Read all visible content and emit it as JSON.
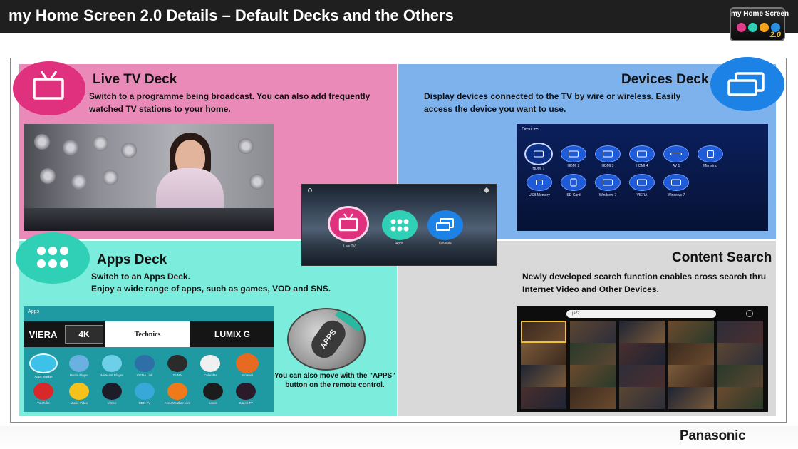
{
  "header": {
    "title": "my Home Screen 2.0 Details – Default Decks and the Others",
    "logo": {
      "text": "my Home Screen",
      "version": "2.0",
      "dot_colors": [
        "#e23b8a",
        "#2fd0b5",
        "#f4a21a",
        "#2a8fe0"
      ]
    }
  },
  "live_tv": {
    "heading": "Live TV Deck",
    "desc": "Switch to a programme being broadcast. You can also add frequently watched TV stations to your home.",
    "icon": "tv-icon",
    "color": "#ea8ab9",
    "accent": "#e0317f"
  },
  "devices": {
    "heading": "Devices Deck",
    "desc": "Display devices connected to the TV by wire or wireless. Easily access the device you want to use.",
    "icon": "devices-icon",
    "color": "#7eb2ec",
    "accent": "#1d82e6",
    "screen_title": "Devices",
    "items": [
      {
        "label": "HDMI 1"
      },
      {
        "label": "HDMI 2"
      },
      {
        "label": "HDMI 3"
      },
      {
        "label": "HDMI 4"
      },
      {
        "label": "AV 1"
      },
      {
        "label": "Mirroring"
      },
      {
        "label": "USB Memory"
      },
      {
        "label": "SD Card"
      },
      {
        "label": "Windows 7"
      },
      {
        "label": "VIERA"
      },
      {
        "label": "Windows 7"
      }
    ]
  },
  "apps": {
    "heading": "Apps Deck",
    "desc_line1": "Switch to an Apps Deck.",
    "desc_line2": "Enjoy a wide range of apps, such as games, VOD and SNS.",
    "icon": "apps-grid-icon",
    "color": "#7cecdc",
    "accent": "#2fd0b5",
    "screen_title": "Apps",
    "brands": [
      "VIERA",
      "4K",
      "Technics",
      "LUMIX G"
    ],
    "items": [
      {
        "label": "Apps Market",
        "color": "#3cc1e8"
      },
      {
        "label": "Media Player",
        "color": "#6ab0e0"
      },
      {
        "label": "Miracast Player",
        "color": "#6ecfe8"
      },
      {
        "label": "VIERA Link",
        "color": "#2e6fa8"
      },
      {
        "label": "DLNA",
        "color": "#2b2b2b"
      },
      {
        "label": "Calendar",
        "color": "#f0f0f0"
      },
      {
        "label": "Browser",
        "color": "#e66a1f"
      },
      {
        "label": "YouTube",
        "color": "#d8282a"
      },
      {
        "label": "Music Video",
        "color": "#f6c21a"
      },
      {
        "label": "Vimeo",
        "color": "#1d1d2a"
      },
      {
        "label": "CBN TV",
        "color": "#38a8d8"
      },
      {
        "label": "AccuWeather.com",
        "color": "#f07a1a"
      },
      {
        "label": "tunein",
        "color": "#1c1c1c"
      },
      {
        "label": "Gazeti TV",
        "color": "#2a1a2a"
      }
    ],
    "remote_button": "APPS",
    "remote_caption": "You can also move with the \"APPS\" button on the remote control."
  },
  "center_tv": {
    "items": [
      {
        "label": "Live TV",
        "color": "#e0317f"
      },
      {
        "label": "Apps",
        "color": "#2fd0b5"
      },
      {
        "label": "Devices",
        "color": "#1d82e6"
      }
    ]
  },
  "content_search": {
    "heading": "Content Search",
    "desc": "Newly developed search function enables cross search thru Internet Video and Other Devices.",
    "color": "#d9d9d9",
    "search_query": "jazz",
    "thumbs": 20
  },
  "footer": {
    "brand": "Panasonic"
  }
}
